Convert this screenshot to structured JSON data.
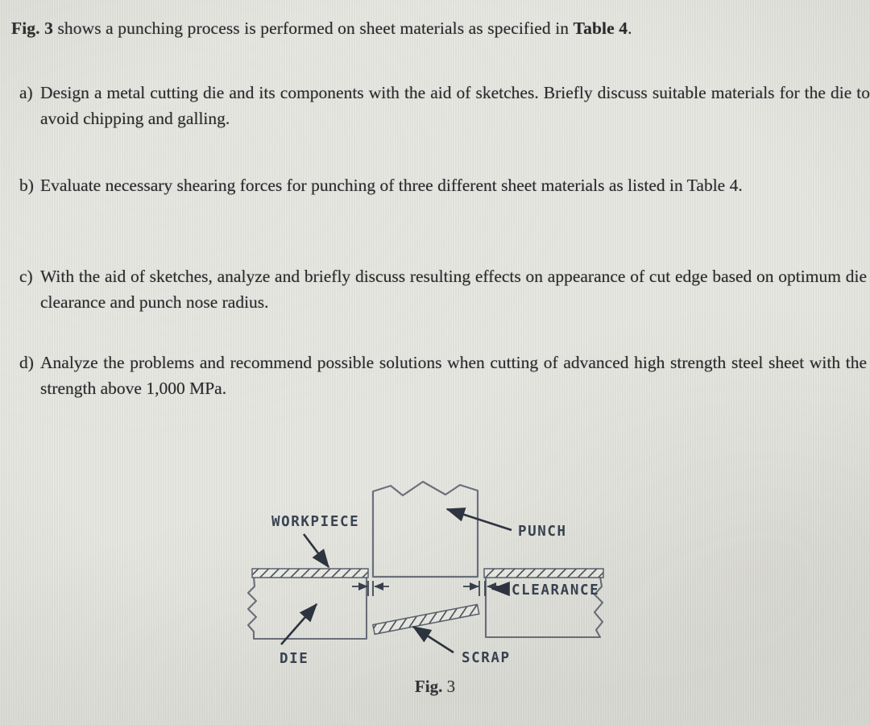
{
  "document": {
    "intro": {
      "prefix_bold": "Fig. 3",
      "middle": " shows a punching process is performed on sheet materials as specified in ",
      "suffix_bold": "Table 4",
      "end": "."
    },
    "items": [
      {
        "marker": "a)",
        "text": "Design a metal cutting die and its components with the aid of sketches. Briefly discuss suitable materials for the die to avoid chipping and galling."
      },
      {
        "marker": "b)",
        "text": "Evaluate necessary shearing forces for punching of three different sheet materials as listed in Table 4."
      },
      {
        "marker": "c)",
        "text": "With the aid of sketches, analyze and briefly discuss resulting effects on appearance of cut edge based on optimum die clearance and punch nose radius."
      },
      {
        "marker": "d)",
        "text": "Analyze the problems and recommend possible solutions when cutting of advanced high strength steel sheet with the strength above 1,000 MPa."
      }
    ]
  },
  "figure": {
    "caption_bold": "Fig.",
    "caption_rest": " 3",
    "labels": {
      "workpiece": "WORKPIECE",
      "punch": "PUNCH",
      "die": "DIE",
      "clearance": "CLEARANCE",
      "scrap": "SCRAP"
    }
  },
  "colors": {
    "page_background": "#e9e9e4",
    "body_text": "#2a2a2d",
    "diagram_line": "#6e7380",
    "diagram_label": "#3a4555",
    "hatch_line": "#4a5260"
  }
}
